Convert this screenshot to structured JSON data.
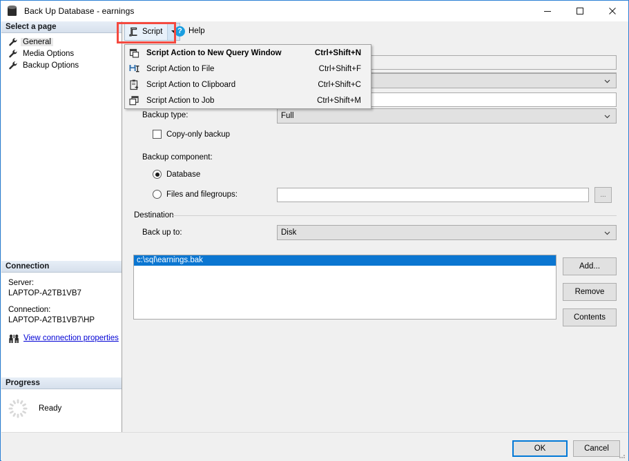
{
  "window": {
    "title": "Back Up Database - earnings",
    "icon": "database-icon",
    "minimize": "—",
    "maximize": "□",
    "close": "✕"
  },
  "sidebar": {
    "select_page_header": "Select a page",
    "pages": [
      {
        "label": "General",
        "icon": "wrench-icon",
        "selected": true
      },
      {
        "label": "Media Options",
        "icon": "wrench-icon",
        "selected": false
      },
      {
        "label": "Backup Options",
        "icon": "wrench-icon",
        "selected": false
      }
    ],
    "connection": {
      "header": "Connection",
      "server_label": "Server:",
      "server_value": "LAPTOP-A2TB1VB7",
      "connection_label": "Connection:",
      "connection_value": "LAPTOP-A2TB1VB7\\HP",
      "link": "View connection properties",
      "link_icon": "connection-people-icon",
      "link_color": "#0000d5"
    },
    "progress": {
      "header": "Progress",
      "status": "Ready",
      "icon": "spinner-icon"
    }
  },
  "toolbar": {
    "script_label": "Script",
    "script_icon": "script-icon",
    "script_dropdown_icon": "chevron-down-icon",
    "help_label": "Help",
    "help_icon": "help-question-icon"
  },
  "script_menu": {
    "items": [
      {
        "label": "Script Action to New Query Window",
        "shortcut": "Ctrl+Shift+N",
        "icon": "new-query-window-icon",
        "highlighted": true
      },
      {
        "label": "Script Action to File",
        "shortcut": "Ctrl+Shift+F",
        "icon": "save-to-file-icon",
        "highlighted": false
      },
      {
        "label": "Script Action to Clipboard",
        "shortcut": "Ctrl+Shift+C",
        "icon": "clipboard-icon",
        "highlighted": false
      },
      {
        "label": "Script Action to Job",
        "shortcut": "Ctrl+Shift+M",
        "icon": "job-window-icon",
        "highlighted": false
      }
    ]
  },
  "form": {
    "backup_type_label": "Backup type:",
    "backup_type_value": "Full",
    "copy_only_label": "Copy-only backup",
    "copy_only_checked": false,
    "backup_component_label": "Backup component:",
    "database_radio_label": "Database",
    "database_radio_selected": true,
    "files_radio_label": "Files and filegroups:",
    "files_radio_selected": false,
    "files_value": "",
    "browse_label": "...",
    "destination_group": "Destination",
    "backup_to_label": "Back up to:",
    "backup_to_value": "Disk",
    "destination_files": [
      {
        "path": "c:\\sql\\earnings.bak",
        "selected": true
      }
    ],
    "add_button": "Add...",
    "remove_button": "Remove",
    "contents_button": "Contents"
  },
  "footer": {
    "ok_label": "OK",
    "cancel_label": "Cancel"
  },
  "colors": {
    "selection_blue": "#0b76d1",
    "focus_blue": "#0078d7",
    "annotation_red": "#f4493f",
    "link_blue": "#0000d5",
    "window_border": "#2a7fd4"
  }
}
